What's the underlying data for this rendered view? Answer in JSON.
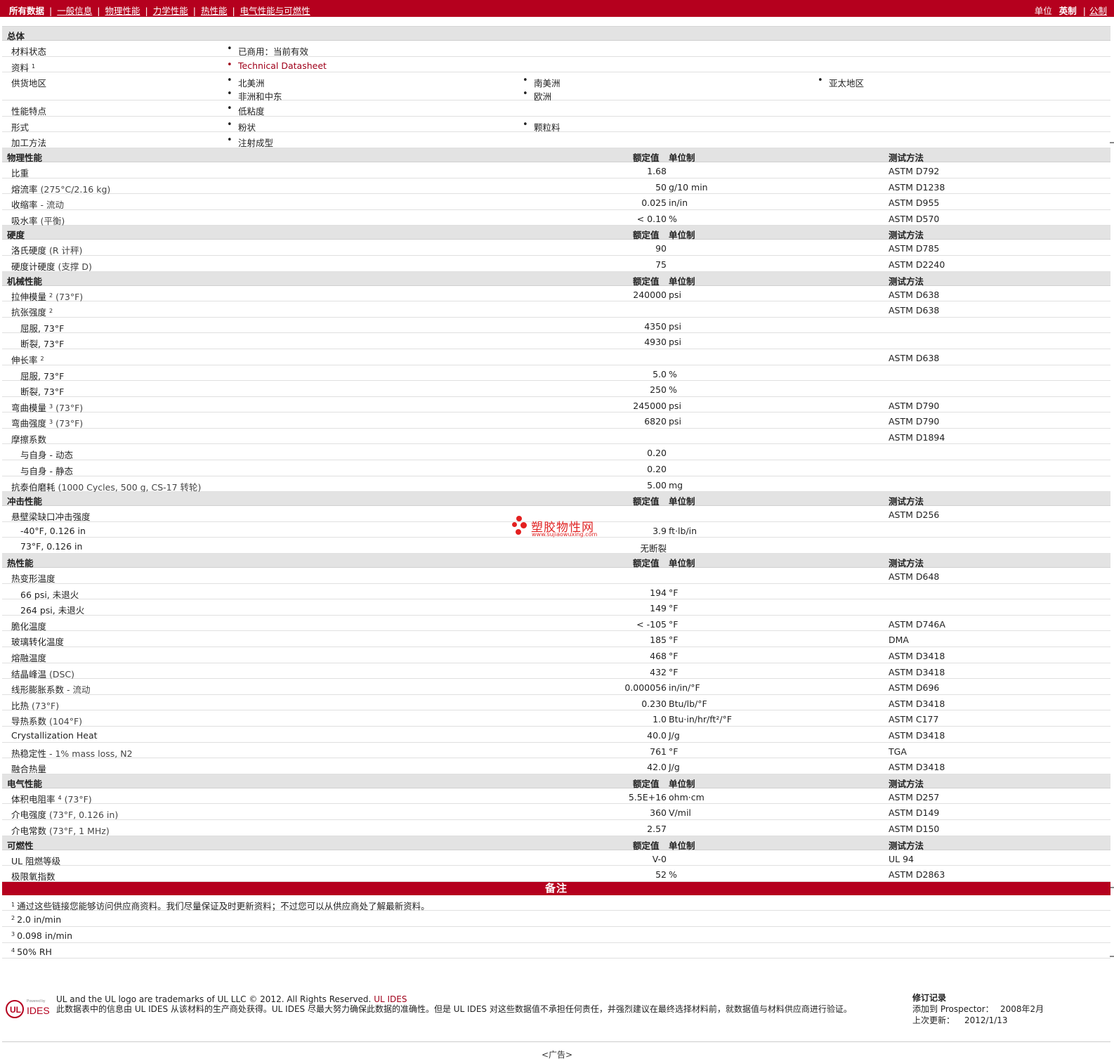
{
  "nav": {
    "items": [
      "所有数据",
      "一般信息",
      "物理性能",
      "力学性能",
      "热性能",
      "电气性能与可燃性"
    ],
    "units_label": "单位",
    "unit_english": "英制",
    "unit_metric": "公制"
  },
  "headers": {
    "nominal": "额定值",
    "unit": "单位制",
    "test": "测试方法"
  },
  "general": {
    "title": "总体",
    "rows": [
      {
        "label": "材料状态",
        "values": [
          "已商用：当前有效"
        ]
      },
      {
        "label": "资料",
        "sup": "1",
        "values": [
          "Technical Datasheet"
        ]
      },
      {
        "label": "供货地区",
        "values": [
          "北美洲",
          "南美洲",
          "亚太地区",
          "非洲和中东",
          "欧洲"
        ]
      },
      {
        "label": "性能特点",
        "values": [
          "低粘度"
        ]
      },
      {
        "label": "形式",
        "values": [
          "粉状",
          "颗粒料"
        ]
      },
      {
        "label": "加工方法",
        "values": [
          "注射成型"
        ]
      }
    ]
  },
  "sections": [
    {
      "title": "物理性能",
      "rows": [
        {
          "label": "比重",
          "value": "1.68",
          "unit": "",
          "test": "ASTM D792"
        },
        {
          "label": "熔流率",
          "note": "(275°C/2.16 kg)",
          "value": "50",
          "unit": "g/10 min",
          "test": "ASTM D1238"
        },
        {
          "label": "收缩率",
          "note": "- 流动",
          "value": "0.025",
          "unit": "in/in",
          "test": "ASTM D955"
        },
        {
          "label": "吸水率",
          "note": "(平衡)",
          "value": "< 0.10",
          "unit": "%",
          "test": "ASTM D570"
        }
      ]
    },
    {
      "title": "硬度",
      "rows": [
        {
          "label": "洛氏硬度",
          "note": "(R 计秤)",
          "value": "90",
          "unit": "",
          "test": "ASTM D785"
        },
        {
          "label": "硬度计硬度",
          "note": "(支撑 D)",
          "value": "75",
          "unit": "",
          "test": "ASTM D2240"
        }
      ]
    },
    {
      "title": "机械性能",
      "rows": [
        {
          "label": "拉伸模量",
          "sup": "2",
          "note": "(73°F)",
          "value": "240000",
          "unit": "psi",
          "test": "ASTM D638"
        },
        {
          "label": "抗张强度",
          "sup": "2",
          "value": "",
          "unit": "",
          "test": "ASTM D638"
        },
        {
          "label": "屈服, 73°F",
          "sub": true,
          "value": "4350",
          "unit": "psi",
          "test": ""
        },
        {
          "label": "断裂, 73°F",
          "sub": true,
          "value": "4930",
          "unit": "psi",
          "test": ""
        },
        {
          "label": "伸长率",
          "sup": "2",
          "value": "",
          "unit": "",
          "test": "ASTM D638"
        },
        {
          "label": "屈服, 73°F",
          "sub": true,
          "value": "5.0",
          "unit": "%",
          "test": ""
        },
        {
          "label": "断裂, 73°F",
          "sub": true,
          "value": "250",
          "unit": "%",
          "test": ""
        },
        {
          "label": "弯曲模量",
          "sup": "3",
          "note": "(73°F)",
          "value": "245000",
          "unit": "psi",
          "test": "ASTM D790"
        },
        {
          "label": "弯曲强度",
          "sup": "3",
          "note": "(73°F)",
          "value": "6820",
          "unit": "psi",
          "test": "ASTM D790"
        },
        {
          "label": "摩擦系数",
          "value": "",
          "unit": "",
          "test": "ASTM D1894"
        },
        {
          "label": "与自身  - 动态",
          "sub": true,
          "value": "0.20",
          "unit": "",
          "test": ""
        },
        {
          "label": "与自身  - 静态",
          "sub": true,
          "value": "0.20",
          "unit": "",
          "test": ""
        },
        {
          "label": "抗泰伯磨耗",
          "note": "(1000 Cycles, 500 g, CS-17 转轮)",
          "value": "5.00",
          "unit": "mg",
          "test": ""
        }
      ]
    },
    {
      "title": "冲击性能",
      "rows": [
        {
          "label": "悬壁梁缺口冲击强度",
          "value": "",
          "unit": "",
          "test": "ASTM D256"
        },
        {
          "label": "-40°F, 0.126 in",
          "sub": true,
          "value": "3.9",
          "unit": "ft·lb/in",
          "test": ""
        },
        {
          "label": "73°F, 0.126 in",
          "sub": true,
          "value": "无断裂",
          "unit": "",
          "test": ""
        }
      ]
    },
    {
      "title": "热性能",
      "rows": [
        {
          "label": "热变形温度",
          "value": "",
          "unit": "",
          "test": "ASTM D648"
        },
        {
          "label": "66 psi, 未退火",
          "sub": true,
          "value": "194",
          "unit": "°F",
          "test": ""
        },
        {
          "label": "264 psi, 未退火",
          "sub": true,
          "value": "149",
          "unit": "°F",
          "test": ""
        },
        {
          "label": "脆化温度",
          "value": "< -105",
          "unit": "°F",
          "test": "ASTM D746A"
        },
        {
          "label": "玻璃转化温度",
          "value": "185",
          "unit": "°F",
          "test": "DMA"
        },
        {
          "label": "熔融温度",
          "value": "468",
          "unit": "°F",
          "test": "ASTM D3418"
        },
        {
          "label": "结晶峰温",
          "note": "(DSC)",
          "value": "432",
          "unit": "°F",
          "test": "ASTM D3418"
        },
        {
          "label": "线形膨胀系数",
          "note": "- 流动",
          "value": "0.000056",
          "unit": "in/in/°F",
          "test": "ASTM D696"
        },
        {
          "label": "比热",
          "note": "(73°F)",
          "value": "0.230",
          "unit": "Btu/lb/°F",
          "test": "ASTM D3418"
        },
        {
          "label": "导热系数",
          "note": "(104°F)",
          "value": "1.0",
          "unit": "Btu·in/hr/ft²/°F",
          "test": "ASTM C177"
        },
        {
          "label": "Crystallization Heat",
          "value": "40.0",
          "unit": "J/g",
          "test": "ASTM D3418"
        },
        {
          "label": "热稳定性",
          "note": "- 1% mass loss, N2",
          "value": "761",
          "unit": "°F",
          "test": "TGA"
        },
        {
          "label": "融合热量",
          "value": "42.0",
          "unit": "J/g",
          "test": "ASTM D3418"
        }
      ]
    },
    {
      "title": "电气性能",
      "rows": [
        {
          "label": "体积电阻率",
          "sup": "4",
          "note": "(73°F)",
          "value": "5.5E+16",
          "unit": "ohm·cm",
          "test": "ASTM D257"
        },
        {
          "label": "介电强度",
          "note": "(73°F, 0.126 in)",
          "value": "360",
          "unit": "V/mil",
          "test": "ASTM D149"
        },
        {
          "label": "介电常数",
          "note": "(73°F, 1 MHz)",
          "value": "2.57",
          "unit": "",
          "test": "ASTM D150"
        }
      ]
    },
    {
      "title": "可燃性",
      "rows": [
        {
          "label": "UL 阻燃等级",
          "value": "V-0",
          "unit": "",
          "test": "UL 94"
        },
        {
          "label": "极限氧指数",
          "value": "52",
          "unit": "%",
          "test": "ASTM D2863"
        }
      ]
    }
  ],
  "notes": {
    "title": "备注",
    "items": [
      {
        "num": "1",
        "text": "通过这些链接您能够访问供应商资料。我们尽量保证及时更新资料；不过您可以从供应商处了解最新资料。"
      },
      {
        "num": "2",
        "text": "2.0 in/min"
      },
      {
        "num": "3",
        "text": "0.098 in/min"
      },
      {
        "num": "4",
        "text": "50% RH"
      }
    ]
  },
  "watermark": {
    "name": "塑胶物性网",
    "url": "www.sujiaowuxing.com"
  },
  "footer": {
    "logo_top": "Powered by",
    "logo_text": "IDES",
    "trademark": "UL and the UL logo are trademarks of UL LLC © 2012. All Rights Reserved.",
    "trademark_link": "UL IDES",
    "disclaimer": "此数据表中的信息由  UL IDES 从该材料的生产商处获得。UL IDES 尽最大努力确保此数据的准确性。但是  UL IDES 对这些数据值不承担任何责任，并强烈建议在最终选择材料前，就数据值与材料供应商进行验证。",
    "revision_title": "修订记录",
    "added_label": "添加到  Prospector：",
    "added_value": "2008年2月",
    "updated_label": "上次更新：",
    "updated_value": "2012/1/13",
    "ad": "<广告>"
  },
  "colors": {
    "brand": "#b5001e",
    "section_bg": "#e3e3e3"
  }
}
